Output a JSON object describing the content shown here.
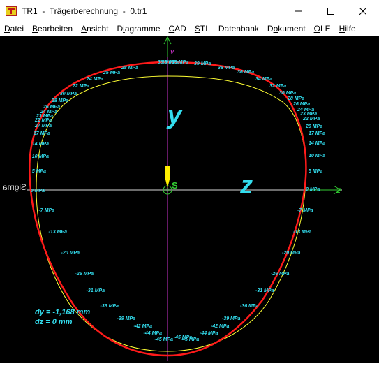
{
  "window": {
    "title": "TR1  -  Trägerberechnung  -  0.tr1"
  },
  "menu": [
    {
      "label": "Datei",
      "key": "D"
    },
    {
      "label": "Bearbeiten",
      "key": "B"
    },
    {
      "label": "Ansicht",
      "key": "A"
    },
    {
      "label": "Diagramme",
      "key": "i"
    },
    {
      "label": "CAD",
      "key": "C"
    },
    {
      "label": "STL",
      "key": "S"
    },
    {
      "label": "Datenbank",
      "key": ""
    },
    {
      "label": "Dokument",
      "key": "o"
    },
    {
      "label": "OLE",
      "key": "O"
    },
    {
      "label": "Hilfe",
      "key": "H"
    }
  ],
  "axes": {
    "v_label": "v",
    "z_small_label": "z",
    "s_label": "S",
    "y_big_label": "y",
    "z_big_label": "z",
    "sigma_label": "Sigma"
  },
  "results": {
    "dy": "dy = -1,168 mm",
    "dz": "dz = 0 mm"
  },
  "stress_left": [
    "28 MPa",
    "25 MPa",
    "24 MPa",
    "22 MPa",
    "30 MPa",
    "28 MPa",
    "26 MPa",
    "24 MPa",
    "23 MPa",
    "22 MPa",
    "27 MPa",
    "17 MPa",
    "14 MPa",
    "10 MPa",
    "5 MPa",
    "0 MPa",
    "-7 MPa",
    "-13 MPa",
    "-20 MPa",
    "-26 MPa",
    "-31 MPa",
    "-36 MPa",
    "-39 MPa",
    "-42 MPa",
    "-44 MPa",
    "-45 MPa"
  ],
  "stress_right": [
    "39 MPa",
    "38 MPa",
    "36 MPa",
    "34 MPa",
    "32 MPa",
    "30 MPa",
    "28 MPa",
    "26 MPa",
    "24 MPa",
    "23 MPa",
    "22 MPa",
    "20 MPa",
    "17 MPa",
    "14 MPa",
    "10 MPa",
    "5 MPa",
    "0 MPa",
    "-7 MPa",
    "-13 MPa",
    "-20 MPa",
    "-26 MPa",
    "-31 MPa",
    "-36 MPa",
    "-39 MPa",
    "-42 MPa",
    "-44 MPa"
  ],
  "stress_top": [
    "39 MPa",
    "39 MPa",
    "39 MPa"
  ],
  "stress_bottom": [
    "-45 MPa",
    "-45 MPa"
  ],
  "colors": {
    "section_outline": "#ff1a1a",
    "stress_curve": "#ffff33",
    "stress_labels": "#33ddee",
    "axis_v": "#cc33cc",
    "axis_z": "#33cc33",
    "big_labels": "#33ddee",
    "load_arrow": "#ffee00"
  }
}
